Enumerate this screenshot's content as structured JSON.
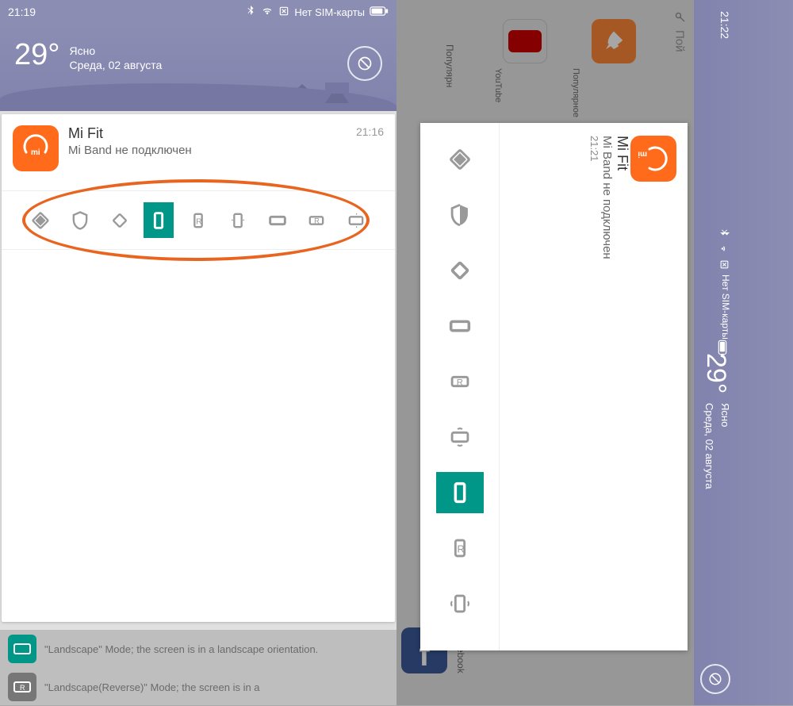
{
  "left": {
    "status_time": "21:19",
    "sim_text": "Нет SIM-карты",
    "temp": "29",
    "temp_unit": "°",
    "weather_cond": "Ясно",
    "date": "Среда, 02 августа",
    "notif": {
      "app": "Mi Fit",
      "body": "Mi Band не подключен",
      "time": "21:16"
    },
    "tiles": {
      "landscape_text": "\"Landscape\" Mode; the screen is in a landscape orientation.",
      "landscape_rev_text": "\"Landscape(Reverse)\" Mode; the screen is in a"
    }
  },
  "right": {
    "status_time": "21:22",
    "sim_text": "Нет SIM-карты",
    "temp": "29",
    "temp_unit": "°",
    "weather_cond": "Ясно",
    "date": "Среда, 02 августа",
    "notif": {
      "app": "Mi Fit",
      "body": "Mi Band не подключен",
      "time": "21:21"
    },
    "home": {
      "search": "Пой",
      "youtube_label": "YouTube",
      "popular": "Популярн",
      "popular2": "Популярное",
      "facebook": "Facebook"
    }
  }
}
